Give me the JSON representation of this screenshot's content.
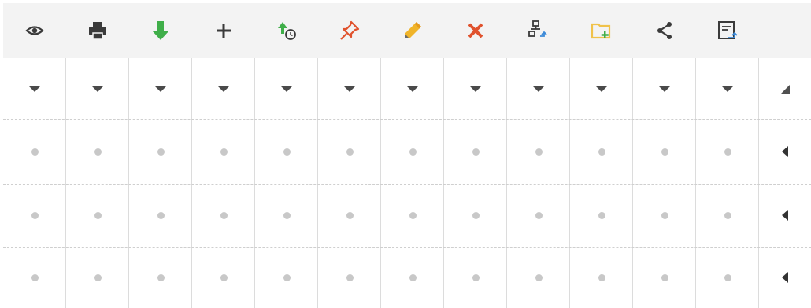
{
  "toolbar": {
    "buttons": [
      {
        "icon": "eye-icon",
        "color": "#3a3a3a"
      },
      {
        "icon": "print-icon",
        "color": "#3a3a3a"
      },
      {
        "icon": "download-arrow-icon",
        "color": "#3fae49"
      },
      {
        "icon": "plus-icon",
        "color": "#3a3a3a"
      },
      {
        "icon": "upload-clock-icon",
        "color": "#3fae49"
      },
      {
        "icon": "pin-icon",
        "color": "#e0522d"
      },
      {
        "icon": "pencil-icon",
        "color": "#f0b429"
      },
      {
        "icon": "close-icon",
        "color": "#e0522d"
      },
      {
        "icon": "hierarchy-icon",
        "color": "#3a3a3a"
      },
      {
        "icon": "folder-add-icon",
        "color": "#f0c24a"
      },
      {
        "icon": "share-icon",
        "color": "#3a3a3a"
      },
      {
        "icon": "report-return-icon",
        "color": "#3a3a3a"
      }
    ],
    "background": "#f3f3f3"
  },
  "grid": {
    "columns": 12,
    "header_row": "dropdown-caret",
    "data_rows": 3,
    "cell_marker": "dot",
    "row_end_marker": "caret-left-icon",
    "header_end_marker": "corner-caret-icon",
    "colors": {
      "dot": "#c8c8c8",
      "caret": "#4a4a4a",
      "lines": "#dcdcdc"
    }
  }
}
